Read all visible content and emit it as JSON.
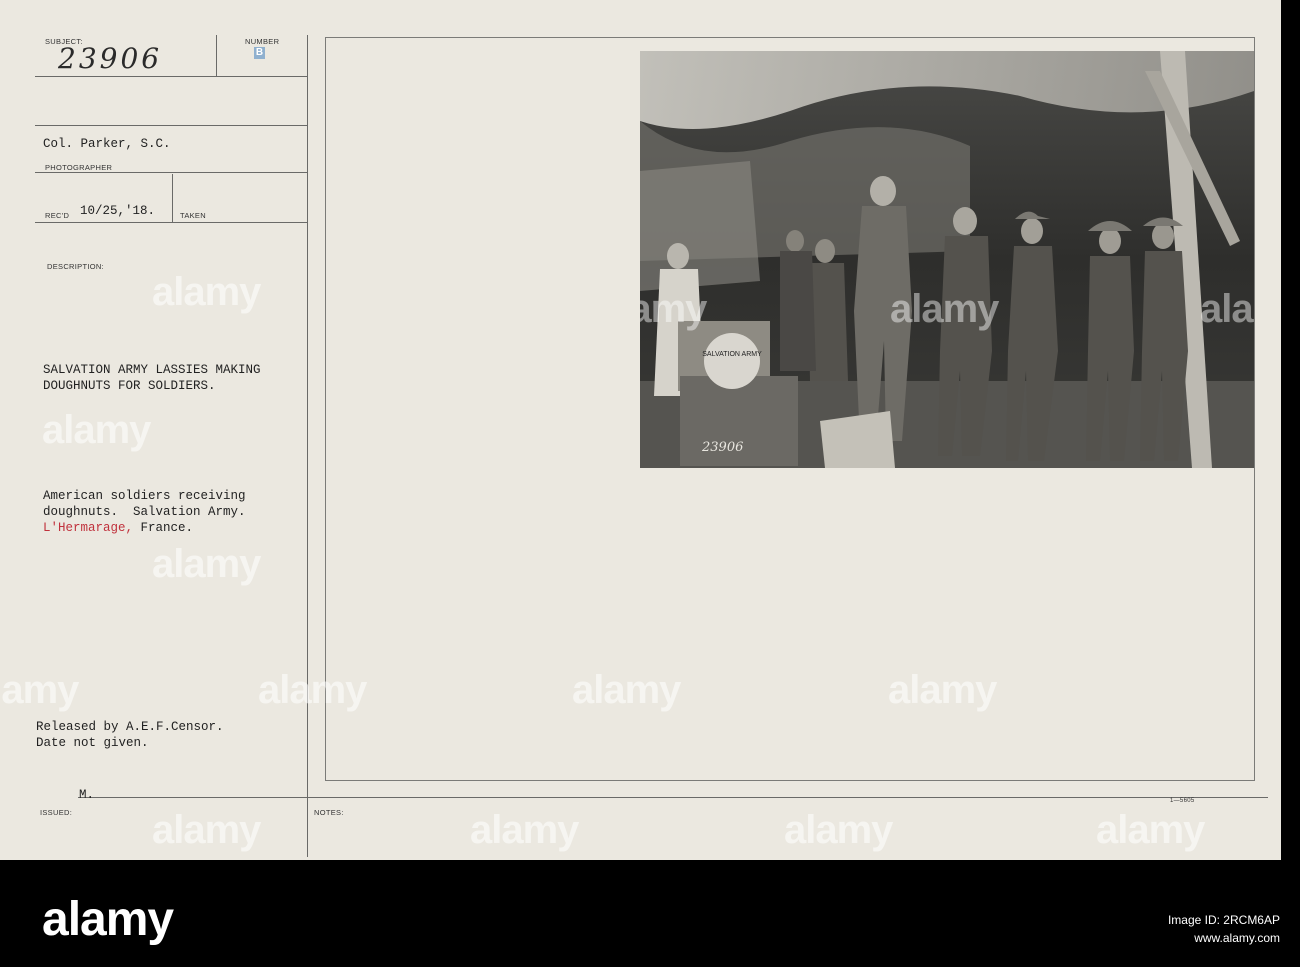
{
  "card": {
    "labels": {
      "subject": "SUBJECT:",
      "number": "NUMBER",
      "photographer": "PHOTOGRAPHER",
      "recd": "REC'D",
      "taken": "TAKEN",
      "description": "DESCRIPTION:",
      "issued": "ISSUED:",
      "notes": "NOTES:"
    },
    "subject_number": "23906",
    "number_stamp": "B",
    "photographer_name": "Col. Parker, S.C.",
    "recd_date": "10/25,'18.",
    "caption_title": "SALVATION ARMY LASSIES MAKING\nDOUGHNUTS FOR SOLDIERS.",
    "caption_line1": "American soldiers receiving",
    "caption_line2": "doughnuts.  Salvation Army.",
    "caption_place": "L'Hermarage,",
    "caption_country": " France.",
    "release_note": "Released by A.E.F.Censor.\nDate not given.",
    "issued_value": "M.",
    "form_code": "1—5605"
  },
  "photo": {
    "sign_text": "SALVATION ARMY",
    "negative_number": "23906"
  },
  "watermark": {
    "text": "alamy"
  },
  "footer": {
    "logo": "alamy",
    "image_id_label": "Image ID: 2RCM6AP",
    "site": "www.alamy.com"
  }
}
